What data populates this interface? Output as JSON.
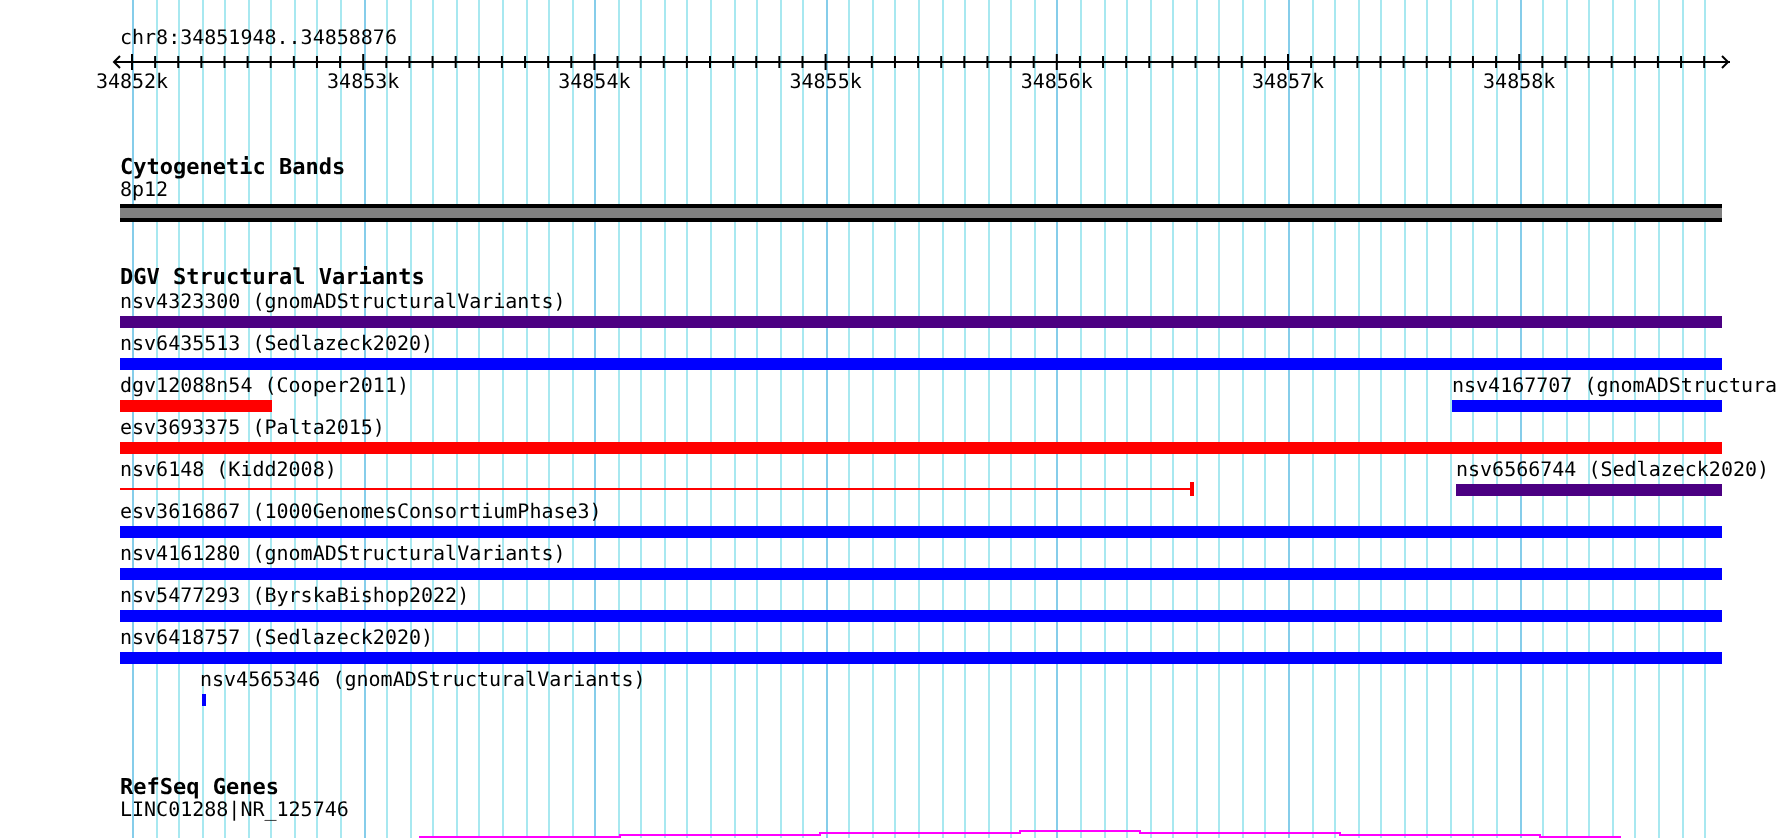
{
  "locus": "chr8:34851948..34858876",
  "ruler": {
    "ticks": [
      "34852k",
      "34853k",
      "34854k",
      "34855k",
      "34856k",
      "34857k",
      "34858k"
    ]
  },
  "cytoband_track": {
    "title": "Cytogenetic Bands",
    "band": "8p12"
  },
  "dgv_track": {
    "title": "DGV Structural Variants",
    "rows": [
      [
        {
          "kind": "bar",
          "label": "nsv4323300 (gnomADStructuralVariants)",
          "color": "#4b0082"
        }
      ],
      [
        {
          "kind": "bar",
          "label": "nsv6435513 (Sedlazeck2020)",
          "color": "#0000ff"
        }
      ],
      [
        {
          "kind": "bar",
          "label": "dgv12088n54 (Cooper2011)",
          "color": "#ff0000"
        },
        {
          "kind": "bar",
          "label": "nsv4167707 (gnomADStructura",
          "color": "#0000ff"
        }
      ],
      [
        {
          "kind": "bar",
          "label": "esv3693375 (Palta2015)",
          "color": "#ff0000"
        }
      ],
      [
        {
          "kind": "line",
          "label": "nsv6148 (Kidd2008)",
          "color": "#ff0000"
        },
        {
          "kind": "bar",
          "label": "nsv6566744 (Sedlazeck2020)",
          "color": "#4b0082"
        }
      ],
      [
        {
          "kind": "bar",
          "label": "esv3616867 (1000GenomesConsortiumPhase3)",
          "color": "#0000ff"
        }
      ],
      [
        {
          "kind": "bar",
          "label": "nsv4161280 (gnomADStructuralVariants)",
          "color": "#0000ff"
        }
      ],
      [
        {
          "kind": "bar",
          "label": "nsv5477293 (ByrskaBishop2022)",
          "color": "#0000ff"
        }
      ],
      [
        {
          "kind": "bar",
          "label": "nsv6418757 (Sedlazeck2020)",
          "color": "#0000ff"
        }
      ],
      [
        {
          "kind": "bar",
          "label": "nsv4565346 (gnomADStructuralVariants)",
          "color": "#0000ff"
        }
      ]
    ]
  },
  "refseq_track": {
    "title": "RefSeq Genes",
    "gene": "LINC01288|NR_125746"
  }
}
